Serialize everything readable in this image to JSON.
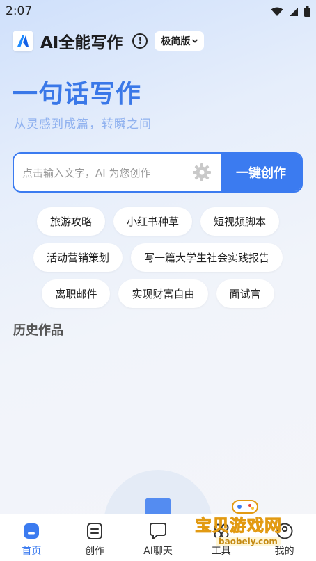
{
  "status_bar": {
    "time": "2:07"
  },
  "header": {
    "title": "AI全能写作",
    "info_symbol": "!",
    "version_label": "极简版"
  },
  "hero": {
    "title": "一句话写作",
    "subtitle": "从灵感到成篇，转瞬之间"
  },
  "input": {
    "placeholder": "点击输入文字，AI 为您创作",
    "button_label": "一键创作"
  },
  "chips": [
    [
      "旅游攻略",
      "小红书种草",
      "短视频脚本"
    ],
    [
      "活动营销策划",
      "写一篇大学生社会实践报告"
    ],
    [
      "离职邮件",
      "实现财富自由",
      "面试官"
    ]
  ],
  "history": {
    "title": "历史作品"
  },
  "tab_bar": {
    "items": [
      {
        "label": "首页",
        "icon": "home-icon",
        "active": true
      },
      {
        "label": "创作",
        "icon": "document-icon",
        "active": false
      },
      {
        "label": "AI聊天",
        "icon": "chat-bubble-icon",
        "active": false
      },
      {
        "label": "工具",
        "icon": "grid-icon",
        "active": false
      },
      {
        "label": "我的",
        "icon": "user-icon",
        "active": false
      }
    ]
  },
  "watermark": {
    "text": "宝贝游戏网",
    "url": "baobeiy.com"
  },
  "colors": {
    "accent": "#3b7bf0",
    "hero_title": "#3a78e8",
    "subtitle": "#8fb1ef"
  }
}
